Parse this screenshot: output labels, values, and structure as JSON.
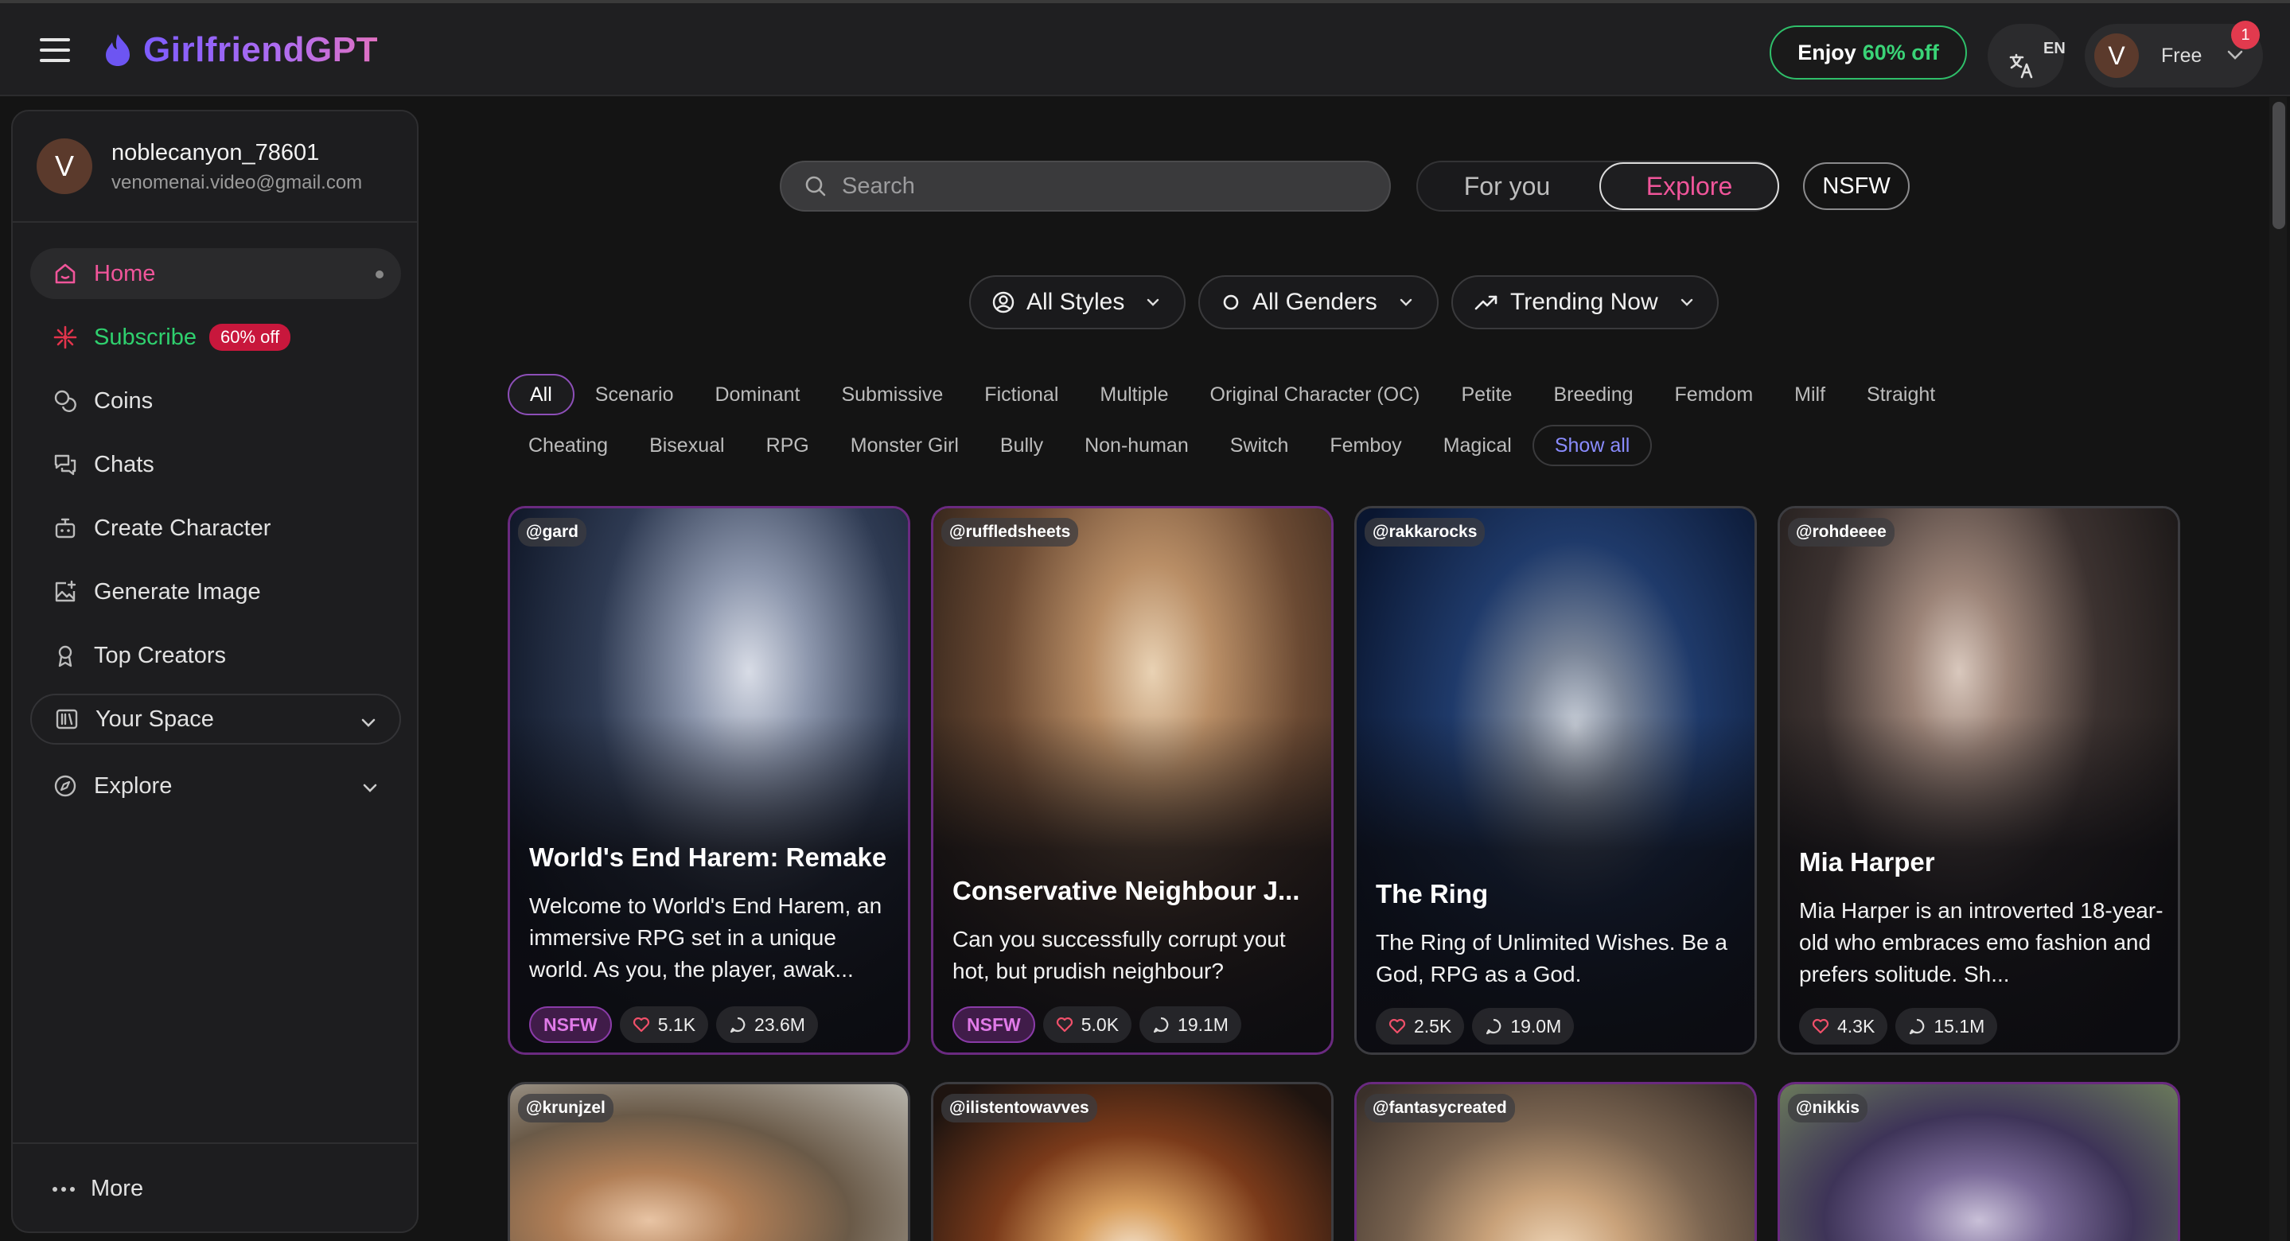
{
  "header": {
    "brand": "GirlfriendGPT",
    "promo": {
      "prefix": "Enjoy",
      "highlight": "60% off"
    },
    "language_code": "EN",
    "avatar_letter": "V",
    "plan": "Free",
    "notification_count": "1"
  },
  "sidebar": {
    "profile": {
      "avatar_letter": "V",
      "username": "noblecanyon_78601",
      "email": "venomenai.video@gmail.com"
    },
    "items": [
      {
        "label": "Home",
        "icon": "home-icon"
      },
      {
        "label": "Subscribe",
        "icon": "sparkle-icon",
        "badge": "60% off"
      },
      {
        "label": "Coins",
        "icon": "coins-icon"
      },
      {
        "label": "Chats",
        "icon": "chats-icon"
      },
      {
        "label": "Create Character",
        "icon": "robot-icon"
      },
      {
        "label": "Generate Image",
        "icon": "image-plus-icon"
      },
      {
        "label": "Top Creators",
        "icon": "award-icon"
      },
      {
        "label": "Your Space",
        "icon": "library-icon"
      },
      {
        "label": "Explore",
        "icon": "compass-icon"
      }
    ],
    "more_label": "More"
  },
  "main": {
    "search_placeholder": "Search",
    "tabs": {
      "for_you": "For you",
      "explore": "Explore"
    },
    "nsfw_label": "NSFW",
    "filters": {
      "styles": "All Styles",
      "genders": "All Genders",
      "sort": "Trending Now"
    },
    "tags_row1": [
      "All",
      "Scenario",
      "Dominant",
      "Submissive",
      "Fictional",
      "Multiple",
      "Original Character (OC)",
      "Petite",
      "Breeding",
      "Femdom",
      "Milf",
      "Straight"
    ],
    "tags_row2": [
      "Cheating",
      "Bisexual",
      "RPG",
      "Monster Girl",
      "Bully",
      "Non-human",
      "Switch",
      "Femboy",
      "Magical"
    ],
    "show_all": "Show all",
    "cards": [
      {
        "handle": "@gard",
        "title": "World's End Harem: Remake",
        "desc": "Welcome to World's End Harem, an immersive RPG set in a unique world. As you, the player, awak...",
        "nsfw": "NSFW",
        "likes": "5.1K",
        "chats": "23.6M"
      },
      {
        "handle": "@ruffledsheets",
        "title": "Conservative Neighbour J...",
        "desc": "Can you successfully corrupt yout hot, but prudish neighbour?",
        "nsfw": "NSFW",
        "likes": "5.0K",
        "chats": "19.1M"
      },
      {
        "handle": "@rakkarocks",
        "title": "The Ring",
        "desc": "The Ring of Unlimited Wishes. Be a God, RPG as a God.",
        "likes": "2.5K",
        "chats": "19.0M"
      },
      {
        "handle": "@rohdeeee",
        "title": "Mia Harper",
        "desc": "Mia Harper is an introverted 18-year-old who embraces emo fashion and prefers solitude. Sh...",
        "likes": "4.3K",
        "chats": "15.1M"
      },
      {
        "handle": "@krunjzel"
      },
      {
        "handle": "@ilistentowavves"
      },
      {
        "handle": "@fantasycreated"
      },
      {
        "handle": "@nikkis"
      }
    ]
  },
  "colors": {
    "accent_pink": "#f0559a",
    "brand_purple": "#8a64ff",
    "promo_green": "#3ad477",
    "nsfw_purple": "#8a3ba8"
  }
}
